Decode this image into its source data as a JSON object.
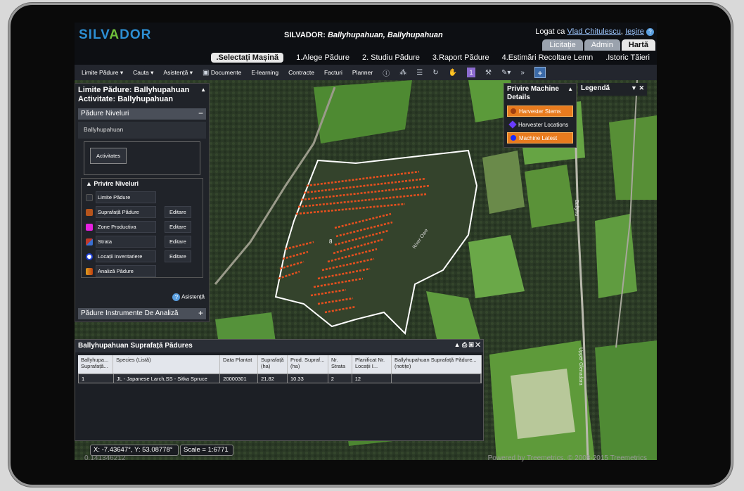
{
  "app": {
    "logo": "SILVADOR",
    "title_prefix": "SILVADOR: ",
    "title_forest": "Ballyhupahuan, Ballyhupahuan",
    "login_label": "Logat ca",
    "user_name": "Vlad Chitulescu",
    "logout": "Ieşire",
    "help_glyph": "?"
  },
  "top_tabs": [
    {
      "label": "Licitație",
      "active": false
    },
    {
      "label": "Admin",
      "active": false
    },
    {
      "label": "Hartă",
      "active": true
    }
  ],
  "steps": [
    {
      "label": ".Selectați Mașină",
      "selected": true
    },
    {
      "label": "1.Alege Pădure"
    },
    {
      "label": "2. Studiu Pădure"
    },
    {
      "label": "3.Raport Pădure"
    },
    {
      "label": "4.Estimări Recoltare Lemn"
    },
    {
      "label": ".Istoric Tăieri"
    }
  ],
  "toolbar": {
    "limite": "Limite Pădure",
    "cauta": "Cauta",
    "asistenta": "Asistență",
    "documente": "Documente",
    "elearning": "E-learning",
    "contracte": "Contracte",
    "facturi": "Facturi",
    "planner": "Planner",
    "one_badge": "1",
    "chevrons": "»",
    "plus": "+"
  },
  "left_panel": {
    "title_line1": "Limite Pădure: Ballyhupahuan",
    "title_line2": "Activitate: Ballyhupahuan",
    "niveluri_header": "Pădure Niveluri",
    "forest_name": "Ballyhupahuan",
    "activitate_btn": "Activitates",
    "privire_header": "Privire Niveluri",
    "layers": [
      {
        "label": "Limite Pădure",
        "color": "#2b2f37",
        "edit": ""
      },
      {
        "label": "Suprafață Pădure",
        "color": "#b5541c",
        "edit": "Editare"
      },
      {
        "label": "Zone Productiva",
        "color": "#e620e0",
        "edit": "Editare"
      },
      {
        "label": "Strata",
        "color": "#c0392b",
        "edit": "Editare"
      },
      {
        "label": "Locații Inventariere",
        "color": "#1e3fd8",
        "edit": "Editare"
      },
      {
        "label": "Analiză Pădure",
        "color": "#e0a020",
        "edit": ""
      }
    ],
    "asistenta": "Asistență",
    "instrumente": "Pădure Instrumente De Analiză",
    "minus": "−",
    "plus": "+"
  },
  "machine_details": {
    "title": "Privire Machine Details",
    "items": [
      {
        "label": "Harvester Stems",
        "style": "orange",
        "dot": "#a04010"
      },
      {
        "label": "Harvester Locations",
        "style": "plain",
        "dot": "#6a3cff"
      },
      {
        "label": "Machine Latest",
        "style": "orange",
        "dot": "#1a2cff"
      }
    ]
  },
  "legend": {
    "title": "Legendă"
  },
  "table": {
    "title": "Ballyhupahuan Suprafață Pădures",
    "columns": [
      "Ballyhupa... Suprafață...",
      "Species (Listă)",
      "Data Plantat",
      "Suprafață (ha)",
      "Prod. Supraf... (ha)",
      "Nr. Strata",
      "Planificat Nr. Locații I...",
      "Ballyhupahuan Suprafață Pădure... (notițe)"
    ],
    "rows": [
      [
        "1",
        "JL - Japanese Larch,SS - Sitka Spruce",
        "20000301",
        "21.82",
        "10.33",
        "2",
        "12",
        ""
      ]
    ]
  },
  "map": {
    "coords": "X: -7.43647°, Y: 53.08778°",
    "scale": "Scale = 1:6771",
    "road1": "Ballyhu",
    "road2": "Upper Glenadara",
    "river": "River Owe"
  },
  "footer": {
    "left_text": "0.141346212",
    "powered": "Powered by Treemetrics. © 2008-2015 Treemetrics"
  },
  "colors": {
    "accent": "#2d8fd3",
    "harvest": "#e8501e",
    "boundary": "#ffffff"
  }
}
